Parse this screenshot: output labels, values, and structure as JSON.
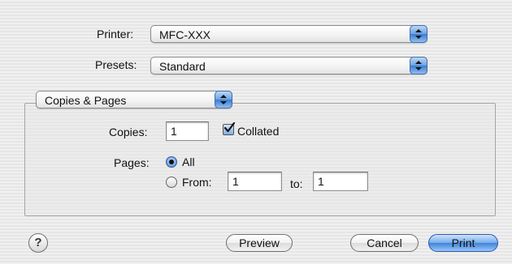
{
  "printer": {
    "label": "Printer:",
    "value": "MFC-XXX"
  },
  "presets": {
    "label": "Presets:",
    "value": "Standard"
  },
  "panel": {
    "value": "Copies & Pages"
  },
  "copies": {
    "label": "Copies:",
    "value": "1",
    "collated_label": "Collated",
    "collated_checked": true
  },
  "pages": {
    "label": "Pages:",
    "all_label": "All",
    "all_selected": true,
    "from_label": "From:",
    "from_value": "1",
    "to_label": "to:",
    "to_value": "1"
  },
  "buttons": {
    "help": "?",
    "preview": "Preview",
    "cancel": "Cancel",
    "print": "Print"
  }
}
